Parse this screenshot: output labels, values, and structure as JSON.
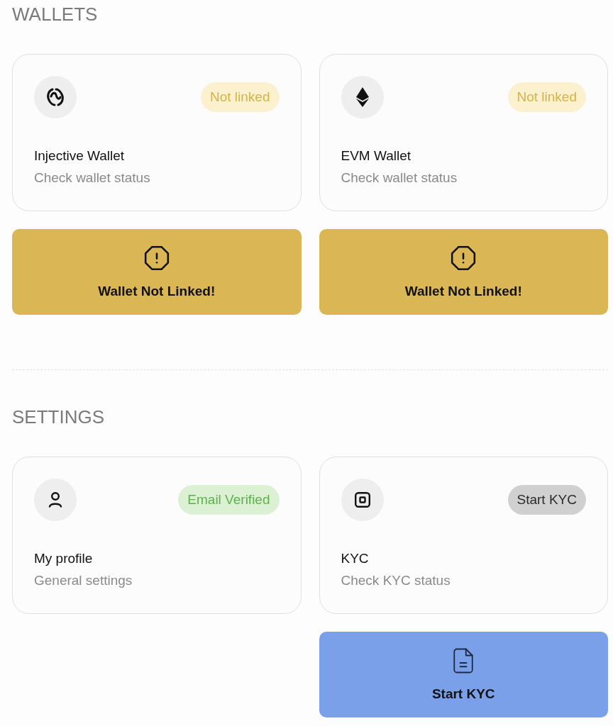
{
  "sections": [
    {
      "heading": "WALLETS",
      "cards": [
        {
          "title": "Injective Wallet",
          "subtitle": "Check wallet status",
          "badge": {
            "label": "Not linked",
            "kind": "warning"
          },
          "action": {
            "label": "Wallet Not Linked!",
            "kind": "warning"
          }
        },
        {
          "title": "EVM Wallet",
          "subtitle": "Check wallet status",
          "badge": {
            "label": "Not linked",
            "kind": "warning"
          },
          "action": {
            "label": "Wallet Not Linked!",
            "kind": "warning"
          }
        }
      ]
    },
    {
      "heading": "SETTINGS",
      "cards": [
        {
          "title": "My profile",
          "subtitle": "General settings",
          "badge": {
            "label": "Email Verified",
            "kind": "success"
          }
        },
        {
          "title": "KYC",
          "subtitle": "Check KYC status",
          "badge": {
            "label": "Start KYC",
            "kind": "neutral"
          },
          "action": {
            "label": "Start KYC",
            "kind": "primary"
          }
        }
      ]
    }
  ]
}
